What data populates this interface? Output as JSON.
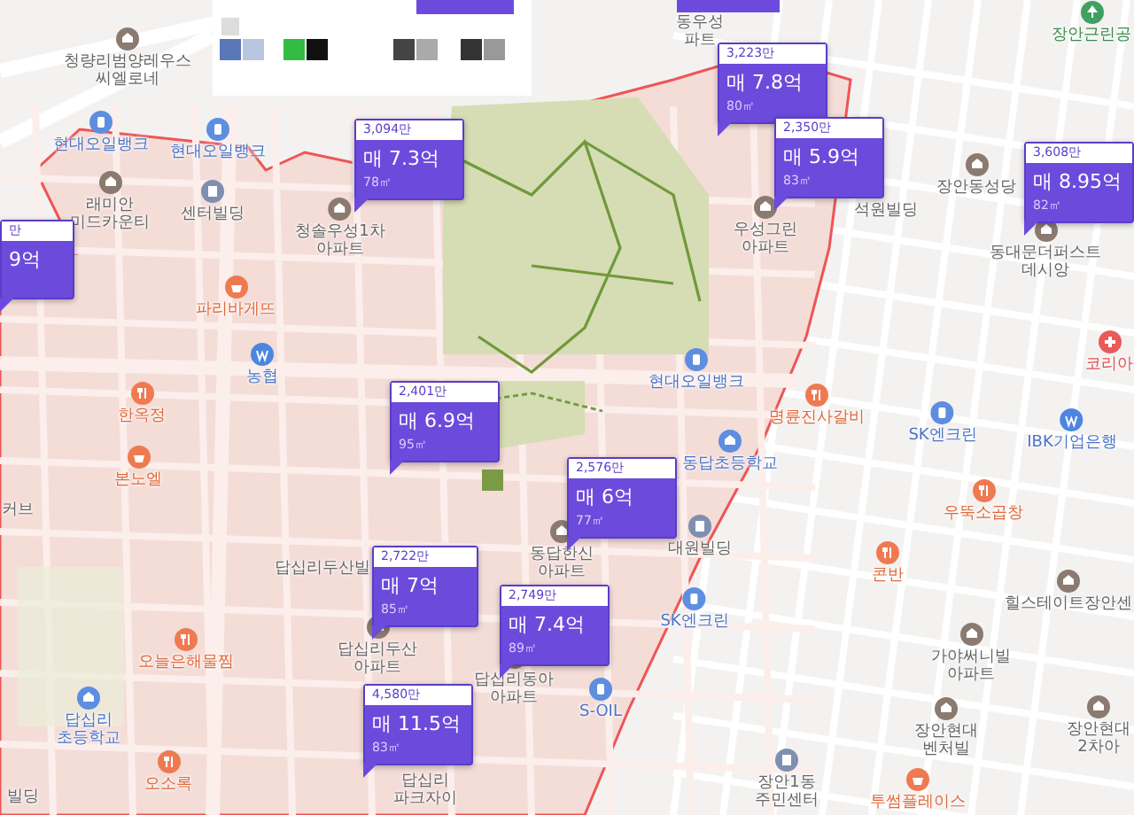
{
  "price_markers": [
    {
      "price_per_pyeong": "만",
      "price": "9억"
    },
    {
      "price_per_pyeong": "3,094만",
      "price": "매 7.3억",
      "area": "78㎡"
    },
    {
      "price_per_pyeong": "3,223만",
      "price": "매 7.8억",
      "area": "80㎡"
    },
    {
      "price_per_pyeong": "2,350만",
      "price": "매 5.9억",
      "area": "83㎡"
    },
    {
      "price_per_pyeong": "3,608만",
      "price": "매 8.95억",
      "area": "82㎡"
    },
    {
      "price_per_pyeong": "2,401만",
      "price": "매 6.9억",
      "area": "95㎡"
    },
    {
      "price_per_pyeong": "2,576만",
      "price": "매 6억",
      "area": "77㎡"
    },
    {
      "price_per_pyeong": "2,722만",
      "price": "매 7억",
      "area": "85㎡"
    },
    {
      "price_per_pyeong": "2,749만",
      "price": "매 7.4억",
      "area": "89㎡"
    },
    {
      "price_per_pyeong": "4,580만",
      "price": "매 11.5억",
      "area": "83㎡"
    }
  ],
  "map_labels": [
    {
      "kind": "apartment",
      "lines": [
        "청량리범양레우스",
        "씨엘로네"
      ]
    },
    {
      "kind": "gas",
      "lines": [
        "현대오일뱅크"
      ]
    },
    {
      "kind": "gas",
      "lines": [
        "현대오일뱅크"
      ]
    },
    {
      "kind": "apartment",
      "lines": [
        "래미안",
        "미드카운티"
      ]
    },
    {
      "kind": "building",
      "lines": [
        "센터빌딩"
      ]
    },
    {
      "kind": "apartment",
      "lines": [
        "청솔우성1차",
        "아파트"
      ]
    },
    {
      "kind": "cafe",
      "lines": [
        "파리바게뜨"
      ]
    },
    {
      "kind": "bank",
      "lines": [
        "농협"
      ]
    },
    {
      "kind": "restaurant",
      "lines": [
        "한옥정"
      ]
    },
    {
      "kind": "cafe",
      "lines": [
        "본노엘"
      ]
    },
    {
      "kind": "text",
      "lines": [
        "커브"
      ]
    },
    {
      "kind": "restaurant",
      "lines": [
        "오늘은해물찜"
      ]
    },
    {
      "kind": "school",
      "lines": [
        "답십리",
        "초등학교"
      ]
    },
    {
      "kind": "restaurant",
      "lines": [
        "오소록"
      ]
    },
    {
      "kind": "text",
      "lines": [
        "빌딩"
      ]
    },
    {
      "kind": "text",
      "lines": [
        "답십리두산빌"
      ]
    },
    {
      "kind": "apartment",
      "lines": [
        "답십리두산",
        "아파트"
      ]
    },
    {
      "kind": "text",
      "lines": [
        "답십리",
        "파크자이"
      ]
    },
    {
      "kind": "text",
      "lines": [
        "동우성",
        "파트"
      ]
    },
    {
      "kind": "apartment",
      "lines": [
        "우성그린",
        "아파트"
      ]
    },
    {
      "kind": "text",
      "lines": [
        "석원빌딩"
      ]
    },
    {
      "kind": "park",
      "lines": [
        "장안근린공"
      ]
    },
    {
      "kind": "apartment",
      "lines": [
        "장안동성당"
      ]
    },
    {
      "kind": "apartment",
      "lines": [
        "동대문더퍼스트",
        "데시앙"
      ]
    },
    {
      "kind": "hospital",
      "lines": [
        "코리아"
      ]
    },
    {
      "kind": "gas",
      "lines": [
        "현대오일뱅크"
      ]
    },
    {
      "kind": "restaurant",
      "lines": [
        "명륜진사갈비"
      ]
    },
    {
      "kind": "gas",
      "lines": [
        "SK엔크린"
      ]
    },
    {
      "kind": "bank",
      "lines": [
        "IBK기업은행"
      ]
    },
    {
      "kind": "school",
      "lines": [
        "동답초등학교"
      ]
    },
    {
      "kind": "restaurant",
      "lines": [
        "우뚝소곱창"
      ]
    },
    {
      "kind": "building",
      "lines": [
        "대원빌딩"
      ]
    },
    {
      "kind": "apartment",
      "lines": [
        "동답한신",
        "아파트"
      ]
    },
    {
      "kind": "restaurant",
      "lines": [
        "콘반"
      ]
    },
    {
      "kind": "gas",
      "lines": [
        "SK엔크린"
      ]
    },
    {
      "kind": "apartment",
      "lines": [
        "힐스테이트장안센"
      ]
    },
    {
      "kind": "apartment",
      "lines": [
        "가야써니빌",
        "아파트"
      ]
    },
    {
      "kind": "apartment",
      "lines": [
        "답십리동아",
        "아파트"
      ]
    },
    {
      "kind": "gas",
      "lines": [
        "S-OIL"
      ]
    },
    {
      "kind": "apartment",
      "lines": [
        "장안현대",
        "벤처빌"
      ]
    },
    {
      "kind": "apartment",
      "lines": [
        "장안현대",
        "2차아"
      ]
    },
    {
      "kind": "building",
      "lines": [
        "장안1동",
        "주민센터"
      ]
    },
    {
      "kind": "cafe",
      "lines": [
        "투썸플레이스"
      ]
    }
  ]
}
